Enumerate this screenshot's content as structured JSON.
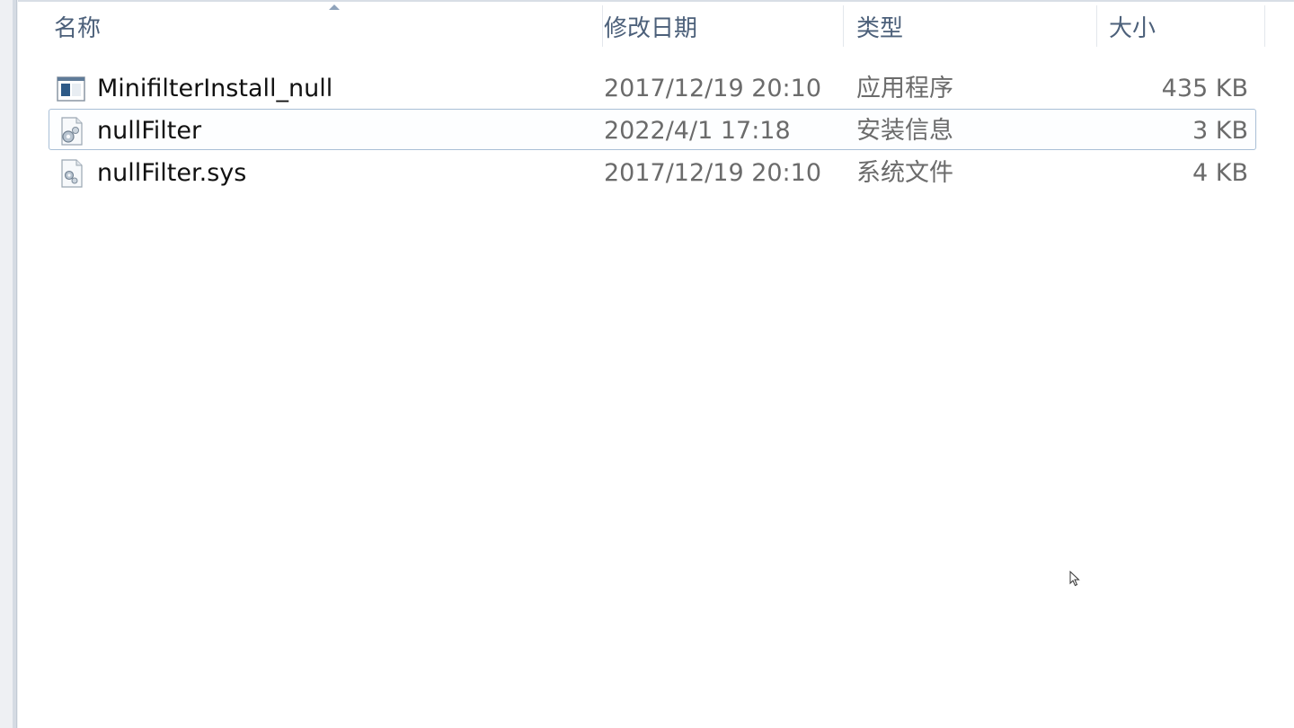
{
  "columns": {
    "name": "名称",
    "modified": "修改日期",
    "type": "类型",
    "size": "大小"
  },
  "files": [
    {
      "name": "MinifilterInstall_null",
      "modified": "2017/12/19 20:10",
      "type": "应用程序",
      "size": "435 KB",
      "icon": "application-icon",
      "selected": false
    },
    {
      "name": "nullFilter",
      "modified": "2022/4/1 17:18",
      "type": "安装信息",
      "size": "3 KB",
      "icon": "setup-information-icon",
      "selected": true
    },
    {
      "name": "nullFilter.sys",
      "modified": "2017/12/19 20:10",
      "type": "系统文件",
      "size": "4 KB",
      "icon": "system-file-icon",
      "selected": false
    }
  ],
  "colors": {
    "header_text": "#4c607a",
    "selection_border": "#a9bfd6",
    "name_text": "#111111",
    "detail_text": "#6b6b6b"
  }
}
